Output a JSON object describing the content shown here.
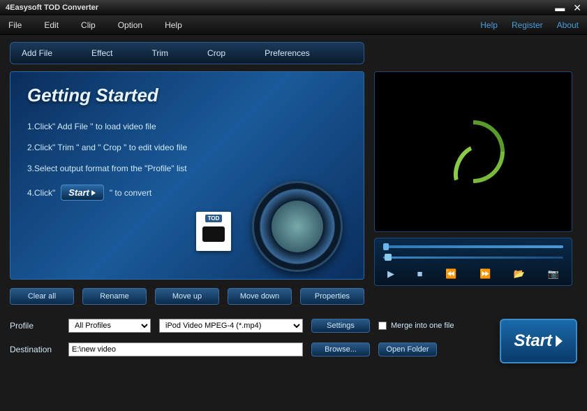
{
  "titlebar": {
    "title": "4Easysoft TOD Converter"
  },
  "menubar": {
    "left": {
      "file": "File",
      "edit": "Edit",
      "clip": "Clip",
      "option": "Option",
      "help": "Help"
    },
    "right": {
      "help": "Help",
      "register": "Register",
      "about": "About"
    }
  },
  "toolbar": {
    "addfile": "Add File",
    "effect": "Effect",
    "trim": "Trim",
    "crop": "Crop",
    "preferences": "Preferences"
  },
  "guide": {
    "title": "Getting Started",
    "step1": "1.Click\" Add File \" to load video file",
    "step2": "2.Click\" Trim \" and \" Crop \" to edit video file",
    "step3": "3.Select output format from the \"Profile\" list",
    "step4a": "4.Click\"",
    "step4btn": "Start",
    "step4b": "\" to convert"
  },
  "actions": {
    "clearall": "Clear all",
    "rename": "Rename",
    "moveup": "Move up",
    "movedown": "Move down",
    "properties": "Properties"
  },
  "profile": {
    "label": "Profile",
    "category": "All Profiles",
    "format": "iPod Video MPEG-4 (*.mp4)",
    "settings": "Settings",
    "merge": "Merge into one file"
  },
  "destination": {
    "label": "Destination",
    "path": "E:\\new video",
    "browse": "Browse...",
    "openfolder": "Open Folder"
  },
  "start": "Start"
}
